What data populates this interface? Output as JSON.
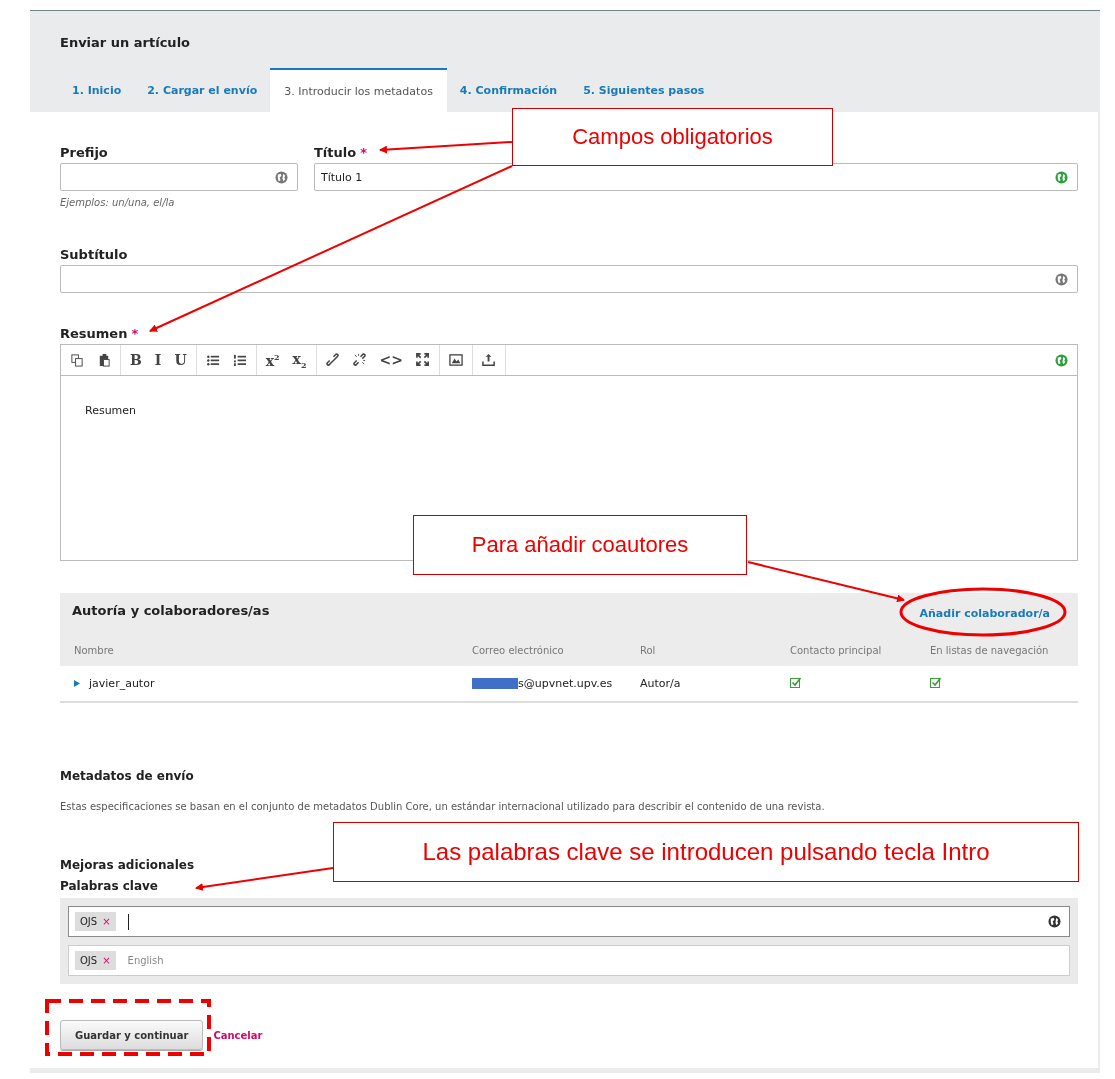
{
  "page_title": "Enviar un artículo",
  "tabs": [
    {
      "label": "1. Inicio",
      "selected": false
    },
    {
      "label": "2. Cargar el envío",
      "selected": false
    },
    {
      "label": "3. Introducir los metadatos",
      "selected": true
    },
    {
      "label": "4. Confirmación",
      "selected": false
    },
    {
      "label": "5. Siguientes pasos",
      "selected": false
    }
  ],
  "prefix": {
    "label": "Prefijo",
    "hint": "Ejemplos: un/una, el/la",
    "complete": false
  },
  "title": {
    "label": "Título",
    "required_mark": "*",
    "value": "Título 1",
    "complete": true
  },
  "subtitle": {
    "label": "Subtítulo",
    "complete": false
  },
  "abstract": {
    "label": "Resumen",
    "required_mark": "*",
    "value": "Resumen",
    "complete": true,
    "toolbar": [
      [
        {
          "kind": "icon"
        },
        {
          "kind": "icon"
        }
      ],
      [
        {
          "kind": "text",
          "label": "B"
        },
        {
          "kind": "text",
          "label": "I"
        },
        {
          "kind": "text",
          "label": "U"
        }
      ],
      [
        {
          "kind": "icon"
        },
        {
          "kind": "icon"
        }
      ],
      [
        {
          "kind": "text",
          "label": "x$^{2}$"
        },
        {
          "kind": "text",
          "label": "x$_{2}$"
        }
      ],
      [
        {
          "kind": "icon"
        },
        {
          "kind": "icon"
        },
        {
          "kind": "text",
          "label": "<>"
        },
        {
          "kind": "icon"
        }
      ],
      [
        {
          "kind": "icon"
        }
      ],
      [
        {
          "kind": "icon"
        }
      ]
    ]
  },
  "contributors": {
    "heading": "Autoría y colaboradores/as",
    "add_link": "Añadir colaborador/a",
    "columns": [
      "Nombre",
      "Correo electrónico",
      "Rol",
      "Contacto principal",
      "En listas de navegación"
    ],
    "rows": [
      {
        "name": "javier_autor",
        "email": "s@upvnet.upv.es",
        "role": "Autor/a",
        "primary_contact": true,
        "in_browse": true
      }
    ]
  },
  "metadata": {
    "heading": "Metadatos de envío",
    "description": "Estas especificaciones se basan en el conjunto de metadatos Dublin Core, un estándar internacional utilizado para describir el contenido de una revista."
  },
  "keywords": {
    "section": "Mejoras adicionales",
    "label": "Palabras clave",
    "lines": [
      {
        "tags": [
          {
            "label": "OJS",
            "remove": "×"
          }
        ],
        "focused": true,
        "globe": true
      },
      {
        "tags": [
          {
            "label": "OJS",
            "remove": "×"
          }
        ],
        "placeholder": "English",
        "focused": false,
        "globe": false
      }
    ]
  },
  "buttons": {
    "save": "Guardar y continuar",
    "cancel": "Cancelar"
  },
  "annotations": [
    "Campos obligatorios",
    "Para añadir coautores",
    "Las palabras clave se introducen pulsando tecla Intro"
  ]
}
